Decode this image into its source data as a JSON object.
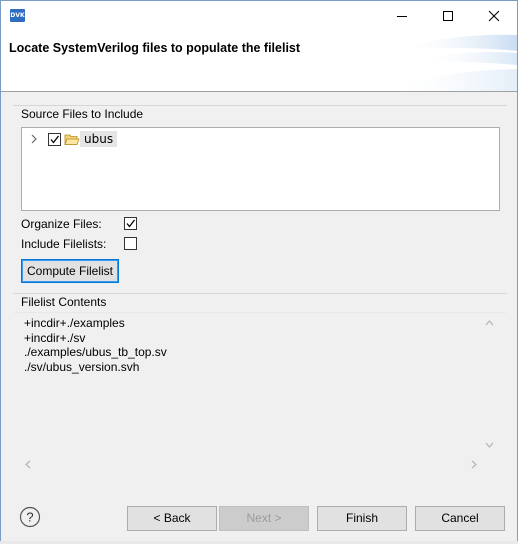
{
  "window": {
    "app_icon_text": "DVK",
    "minimize_icon": "minimize-icon",
    "maximize_icon": "maximize-icon",
    "close_icon": "close-icon"
  },
  "header": {
    "title": "Locate SystemVerilog files to populate the filelist"
  },
  "source_files": {
    "group_label": "Source Files to Include",
    "tree": [
      {
        "label": "ubus",
        "checked": true,
        "expanded": false,
        "icon": "folder-icon"
      }
    ]
  },
  "options": {
    "organize_files_label": "Organize Files:",
    "organize_files_checked": true,
    "include_filelists_label": "Include Filelists:",
    "include_filelists_checked": false
  },
  "compute_button_label": "Compute Filelist",
  "filelist_contents": {
    "group_label": "Filelist Contents",
    "lines": [
      "+incdir+./examples",
      "+incdir+./sv",
      "./examples/ubus_tb_top.sv",
      "./sv/ubus_version.svh"
    ]
  },
  "footer": {
    "help_icon": "help-icon",
    "back_label": "< Back",
    "next_label": "Next >",
    "finish_label": "Finish",
    "cancel_label": "Cancel",
    "next_enabled": false
  },
  "colors": {
    "accent": "#0078d7",
    "dialog_bg": "#f0f0f0"
  }
}
